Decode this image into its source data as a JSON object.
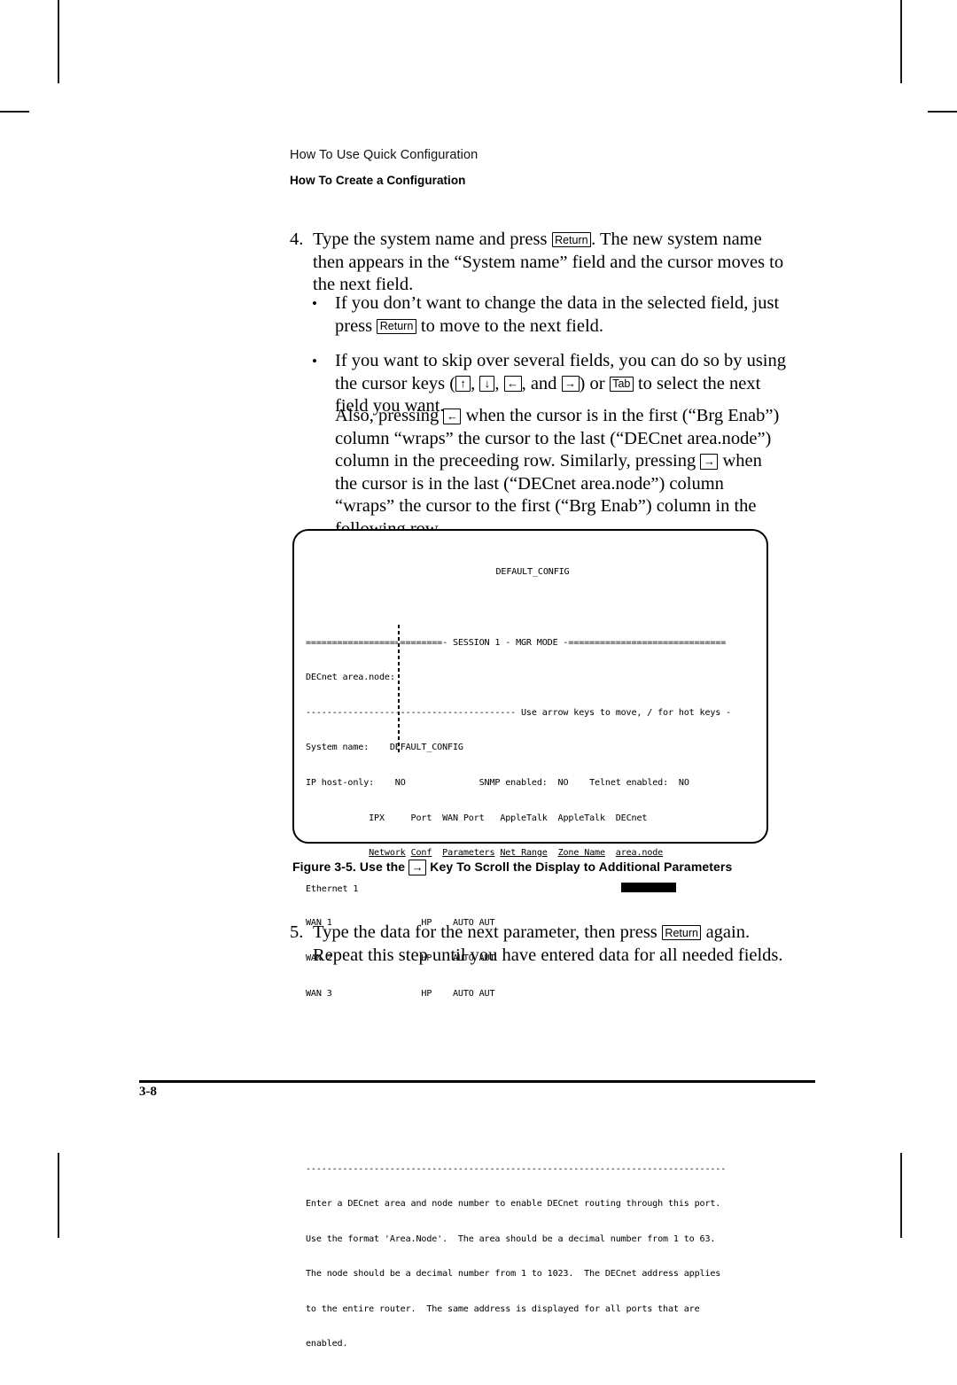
{
  "page": {
    "running_head": "How To Use Quick Configuration",
    "running_subhead": "How To Create a Configuration",
    "folio": "3-8"
  },
  "steps": {
    "step4": {
      "number": "4.",
      "text_a": "Type the system name and press ",
      "key_return": "Return",
      "text_b": ". The new system name then appears in the “System name” field and the cursor moves to the next field."
    },
    "step5": {
      "number": "5.",
      "text_a": "Type the data for the next parameter, then press ",
      "key_return": "Return",
      "text_b": " again. Repeat this step until you have entered data for all needed fields."
    }
  },
  "bullets": [
    {
      "marker": "•",
      "text_a": "If you don’t want to change the data in the selected field, just press ",
      "key_return": "Return",
      "text_b": " to move to the next field."
    },
    {
      "marker": "•",
      "text_a": "If you want to skip over several fields, you can do so by using the cursor keys (",
      "key_up": "↑",
      "sep1": ", ",
      "key_down": "↓",
      "sep2": ", ",
      "key_left": "←",
      "sep3": ", and ",
      "key_right": "→",
      "sep4": ") or ",
      "key_tab": "Tab",
      "text_b": " to select the next field you want."
    }
  ],
  "paragraph_also": {
    "text_a": "Also, pressing ",
    "key_left": "←",
    "text_b": " when the cursor is in the first (“Brg Enab”) column “wraps” the cursor to the last (“DECnet area.node”) column in the preceeding row. Similarly, pressing ",
    "key_right": "→",
    "text_c": " when the cursor is in the last (“DECnet area.node”) column “wraps” the cursor to the first (“Brg Enab”) column in the following row."
  },
  "figure": {
    "caption_a": "Figure  3-5.  Use the ",
    "caption_key": "→",
    "caption_b": " Key To Scroll the Display to Additional Parameters"
  },
  "terminal": {
    "title": "DEFAULT_CONFIG",
    "session_bar": "==========================- SESSION 1 - MGR MODE -==============================",
    "prompt_field": "DECnet area.node:",
    "hint_bar": "---------------------------------------- Use arrow keys to move, / for hot keys -",
    "system_name_label": "System name:",
    "system_name_value": "DEFAULT_CONFIG",
    "ip_host_only_label": "IP host-only:",
    "ip_host_only_value": "NO",
    "snmp_label": "SNMP enabled:",
    "snmp_value": "NO",
    "telnet_label": "Telnet enabled:",
    "telnet_value": "NO",
    "columns_row1": [
      "IPX",
      "Port",
      "WAN Port",
      "AppleTalk",
      "AppleTalk",
      "DECnet"
    ],
    "columns_row2": [
      "Network",
      "Conf",
      "Parameters",
      "Net Range",
      "Zone Name",
      "area.node"
    ],
    "rows": [
      {
        "port": "Ethernet 1",
        "ipx_network": "",
        "port_conf": "",
        "wan_port_parameters": "",
        "appletalk_net_range": "",
        "appletalk_zone_name": "",
        "decnet_area_node": "",
        "cursor": true
      },
      {
        "port": "WAN 1",
        "ipx_network": "",
        "port_conf": "HP",
        "wan_port_parameters": "AUTO AUT",
        "appletalk_net_range": "",
        "appletalk_zone_name": "",
        "decnet_area_node": "",
        "cursor": false
      },
      {
        "port": "WAN 2",
        "ipx_network": "",
        "port_conf": "HP",
        "wan_port_parameters": "AUTO AUT",
        "appletalk_net_range": "",
        "appletalk_zone_name": "",
        "decnet_area_node": "",
        "cursor": false
      },
      {
        "port": "WAN 3",
        "ipx_network": "",
        "port_conf": "HP",
        "wan_port_parameters": "AUTO AUT",
        "appletalk_net_range": "",
        "appletalk_zone_name": "",
        "decnet_area_node": "",
        "cursor": false
      }
    ],
    "help_divider": "--------------------------------------------------------------------------------",
    "help_lines": [
      "Enter a DECnet area and node number to enable DECnet routing through this port.",
      "Use the format 'Area.Node'.  The area should be a decimal number from 1 to 63.",
      "The node should be a decimal number from 1 to 1023.  The DECnet address applies",
      "to the entire router.  The same address is displayed for all ports that are",
      "enabled."
    ]
  }
}
